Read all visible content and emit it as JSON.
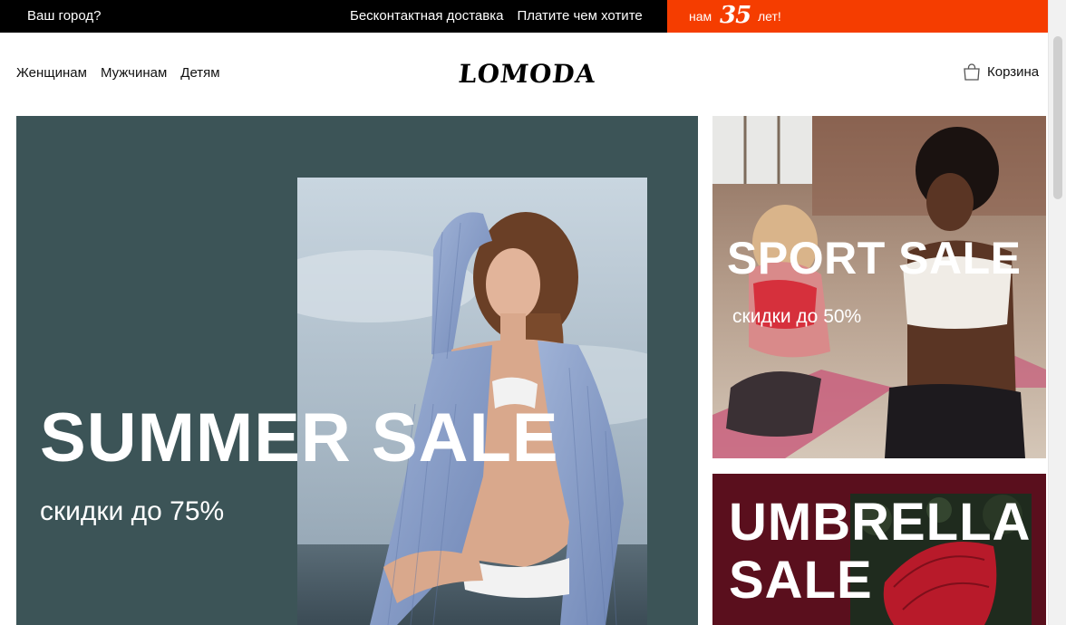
{
  "topbar": {
    "city": "Ваш город?",
    "links": [
      "Бесконтактная доставка",
      "Платите чем хотите"
    ],
    "anniversary": {
      "pre": "нам",
      "number": "35",
      "post": "лет!"
    }
  },
  "header": {
    "nav": [
      "Женщинам",
      "Мужчинам",
      "Детям"
    ],
    "logo": "LOMODA",
    "cart_label": "Корзина",
    "cart_icon": "shopping-bag-icon"
  },
  "banners": {
    "main": {
      "title": "SUMMER SALE",
      "subtitle": "скидки до 75%"
    },
    "sport": {
      "title": "SPORT SALE",
      "subtitle": "скидки до 50%"
    },
    "umbrella": {
      "title_line1": "UMBRELLA",
      "title_line2": "SALE"
    }
  },
  "colors": {
    "topbar_bg": "#000000",
    "accent": "#f53d00",
    "main_banner_bg": "#3c5457",
    "umbrella_banner_bg": "#5a0f1d"
  }
}
